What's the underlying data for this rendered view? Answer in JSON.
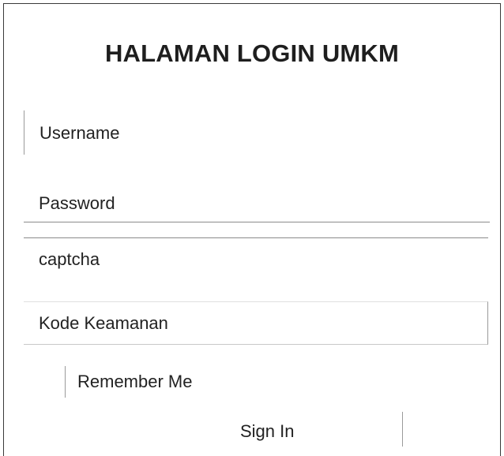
{
  "login": {
    "title": "HALAMAN LOGIN UMKM",
    "username_placeholder": "Username",
    "password_placeholder": "Password",
    "captcha_label": "captcha",
    "security_code_placeholder": "Kode Keamanan",
    "remember_label": "Remember Me",
    "sign_in_label": "Sign In"
  }
}
